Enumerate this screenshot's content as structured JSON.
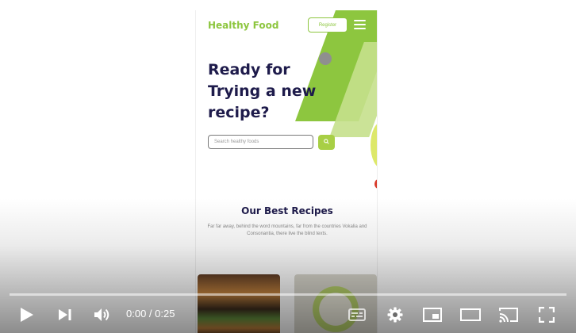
{
  "site": {
    "brand": "Healthy Food",
    "register_label": "Register",
    "hero_title": "Ready for Trying a new recipe?",
    "search_placeholder": "Search healthy foods",
    "best_recipes_title": "Our Best Recipes",
    "best_recipes_desc": "Far far away, behind the word mountains, far from the countries Vokalia and Consonantia, there live the blind texts."
  },
  "player": {
    "current_time": "0:00",
    "duration": "0:25",
    "time_display": "0:00 / 0:25",
    "progress": 0,
    "controls": [
      "play-icon",
      "next-icon",
      "volume-icon",
      "subtitles-icon",
      "settings-icon",
      "miniplayer-icon",
      "theater-icon",
      "cast-icon",
      "fullscreen-icon"
    ]
  },
  "colors": {
    "brand_green": "#8dc63f",
    "title_navy": "#1e1b4b",
    "progress_red": "#ff0000"
  }
}
